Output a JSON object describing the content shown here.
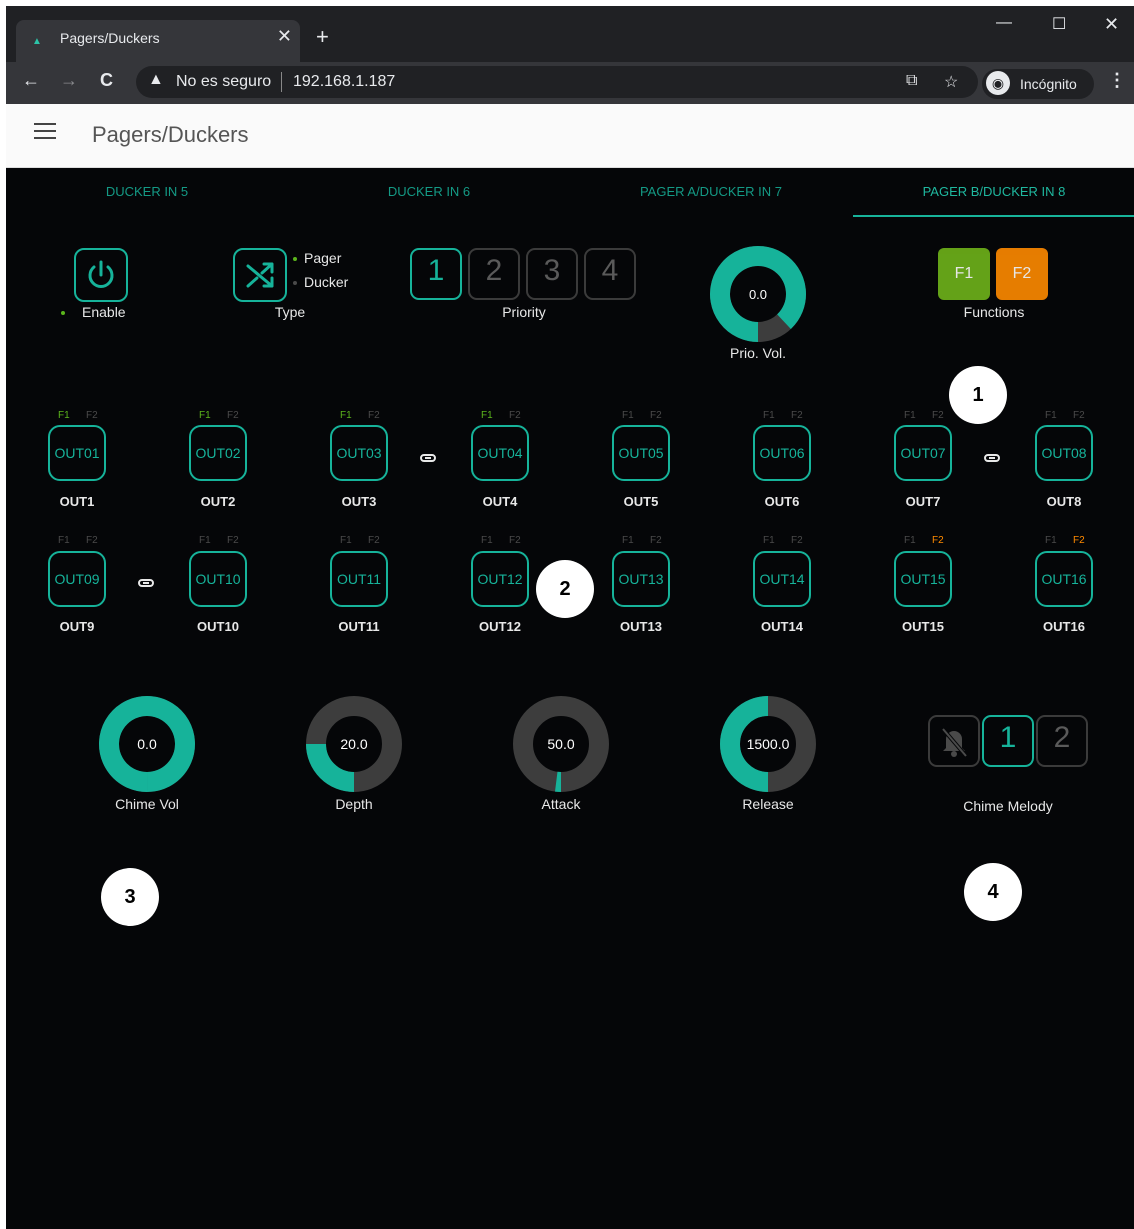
{
  "browser": {
    "tab_title": "Pagers/Duckers",
    "security_label": "No es seguro",
    "url": "192.168.1.187",
    "incognito_label": "Incógnito"
  },
  "app": {
    "title": "Pagers/Duckers",
    "tabs": [
      {
        "label": "DUCKER IN 5",
        "active": false
      },
      {
        "label": "DUCKER IN 6",
        "active": false
      },
      {
        "label": "PAGER A/DUCKER IN 7",
        "active": false
      },
      {
        "label": "PAGER B/DUCKER IN 8",
        "active": true
      }
    ]
  },
  "controls": {
    "enable_label": "Enable",
    "type_label": "Type",
    "type_options": [
      "Pager",
      "Ducker"
    ],
    "priority_label": "Priority",
    "priority_options": [
      "1",
      "2",
      "3",
      "4"
    ],
    "priority_selected": "1",
    "prio_vol": {
      "label": "Prio. Vol.",
      "value": "0.0",
      "level": 0.88
    },
    "functions_label": "Functions",
    "functions": [
      {
        "label": "F1",
        "color": "#6fb31a"
      },
      {
        "label": "F2",
        "color": "#ff8a00"
      }
    ]
  },
  "outputs": [
    {
      "button": "OUT01",
      "name": "OUT1",
      "f1": true,
      "f2": false
    },
    {
      "button": "OUT02",
      "name": "OUT2",
      "f1": true,
      "f2": false
    },
    {
      "button": "OUT03",
      "name": "OUT3",
      "f1": true,
      "f2": false
    },
    {
      "button": "OUT04",
      "name": "OUT4",
      "f1": true,
      "f2": false
    },
    {
      "button": "OUT05",
      "name": "OUT5",
      "f1": false,
      "f2": false
    },
    {
      "button": "OUT06",
      "name": "OUT6",
      "f1": false,
      "f2": false
    },
    {
      "button": "OUT07",
      "name": "OUT7",
      "f1": false,
      "f2": false
    },
    {
      "button": "OUT08",
      "name": "OUT8",
      "f1": false,
      "f2": false
    },
    {
      "button": "OUT09",
      "name": "OUT9",
      "f1": false,
      "f2": false
    },
    {
      "button": "OUT10",
      "name": "OUT10",
      "f1": false,
      "f2": false
    },
    {
      "button": "OUT11",
      "name": "OUT11",
      "f1": false,
      "f2": false
    },
    {
      "button": "OUT12",
      "name": "OUT12",
      "f1": false,
      "f2": false
    },
    {
      "button": "OUT13",
      "name": "OUT13",
      "f1": false,
      "f2": false
    },
    {
      "button": "OUT14",
      "name": "OUT14",
      "f1": false,
      "f2": false
    },
    {
      "button": "OUT15",
      "name": "OUT15",
      "f1": false,
      "f2": true
    },
    {
      "button": "OUT16",
      "name": "OUT16",
      "f1": false,
      "f2": true
    }
  ],
  "flag_labels": {
    "f1": "F1",
    "f2": "F2"
  },
  "knobs": [
    {
      "label": "Chime Vol",
      "value": "0.0",
      "level": 1.0
    },
    {
      "label": "Depth",
      "value": "20.0",
      "level": 0.25
    },
    {
      "label": "Attack",
      "value": "50.0",
      "level": 0.02
    },
    {
      "label": "Release",
      "value": "1500.0",
      "level": 0.5
    }
  ],
  "chime_melody": {
    "label": "Chime Melody",
    "options": [
      "1",
      "2"
    ],
    "selected": "1"
  },
  "callouts": [
    "1",
    "2",
    "3",
    "4"
  ],
  "colors": {
    "accent": "#16b39a",
    "background": "#050608",
    "track": "#3d3d3d"
  }
}
